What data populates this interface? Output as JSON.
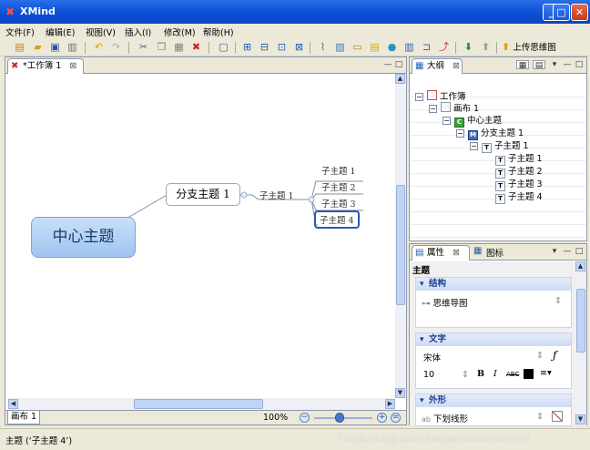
{
  "window": {
    "title": "XMind",
    "min_glyph": "_",
    "max_glyph": "□",
    "close_glyph": "✕"
  },
  "menu": [
    "文件(F)",
    "编辑(E)",
    "视图(V)",
    "插入(I)",
    "修改(M)",
    "帮助(H)"
  ],
  "toolbar": {
    "upload_label": "上传思维图"
  },
  "editor": {
    "tab_label": "*工作簿 1",
    "central_topic": "中心主题",
    "branch_topic": "分支主题 1",
    "sub_branch": "子主题 1",
    "leaf_topics": [
      "子主题 1",
      "子主题 2",
      "子主题 3",
      "子主题 4"
    ],
    "sheet_tab": "画布 1",
    "zoom": "100%"
  },
  "outline": {
    "tab_label": "大纲",
    "tree": [
      {
        "label": "工作簿",
        "icon": "workbook"
      },
      {
        "label": "画布 1",
        "icon": "sheet"
      },
      {
        "label": "中心主题",
        "icon": "central",
        "badge": "C"
      },
      {
        "label": "分支主题 1",
        "icon": "main",
        "badge": "M"
      },
      {
        "label": "子主题 1",
        "icon": "topic",
        "badge": "T"
      },
      {
        "label": "子主题 1",
        "icon": "topic",
        "badge": "T"
      },
      {
        "label": "子主题 2",
        "icon": "topic",
        "badge": "T"
      },
      {
        "label": "子主题 3",
        "icon": "topic",
        "badge": "T"
      },
      {
        "label": "子主题 4",
        "icon": "topic",
        "badge": "T"
      }
    ]
  },
  "properties": {
    "tab_label": "属性",
    "icon_tab_label": "图标",
    "title": "主题",
    "structure_header": "结构",
    "structure_value": "思维导图",
    "text_header": "文字",
    "font_name": "宋体",
    "font_size": "10",
    "shape_header": "外形",
    "shape_value": "下划线形"
  },
  "status": {
    "text": "主题 (‘子主题 4’)",
    "watermark": "https://blog.csdn.net/persistence2020"
  },
  "colors": {
    "titlebar": "#0a4fd8",
    "selection": "#2b56b8",
    "central_fill": "#9fc4ef"
  }
}
